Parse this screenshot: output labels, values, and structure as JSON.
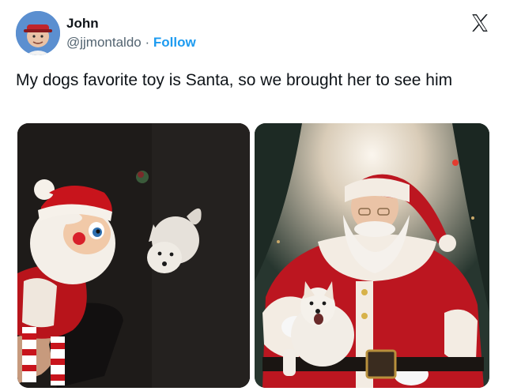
{
  "tweet": {
    "author_name": "John",
    "handle": "@jjmontaldo",
    "separator": "·",
    "follow_label": "Follow",
    "text": "My dogs favorite toy is Santa, so we brought her to see him"
  },
  "icons": {
    "platform": "x-logo-icon"
  },
  "colors": {
    "follow": "#1d9bf0",
    "secondary_text": "#536471",
    "santa_red": "#c8141c"
  }
}
